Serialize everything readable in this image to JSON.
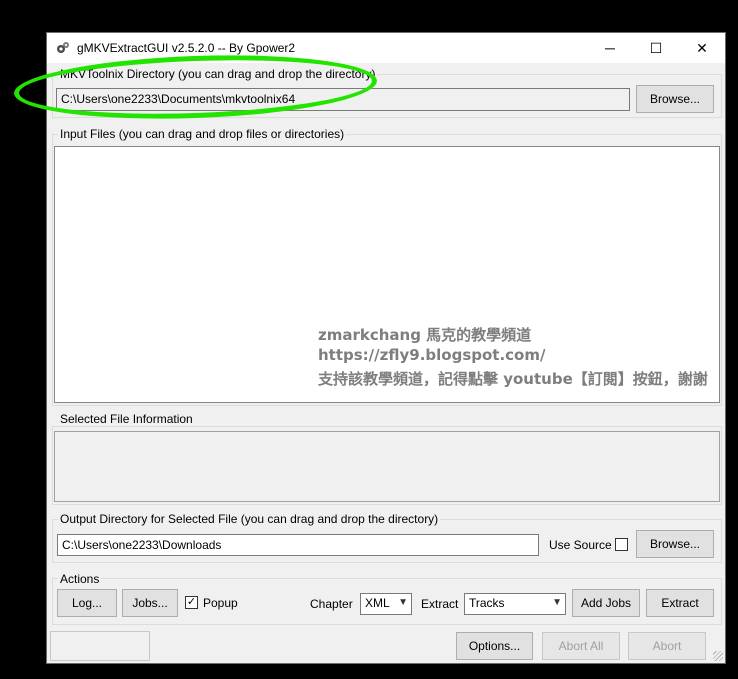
{
  "window": {
    "title": "gMKVExtractGUI v2.5.2.0 -- By Gpower2"
  },
  "window_controls": {
    "minimize": "─",
    "maximize": "☐",
    "close": "✕"
  },
  "mkvtoolnix": {
    "legend": "MKVToolnix Directory (you can drag and drop the directory)",
    "path": "C:\\Users\\one2233\\Documents\\mkvtoolnix64",
    "browse": "Browse..."
  },
  "input_files": {
    "legend": "Input Files (you can drag and drop files or directories)"
  },
  "watermark": {
    "line1": "zmarkchang 馬克的教學頻道",
    "line2": "https://zfly9.blogspot.com/",
    "line3": "支持該教學頻道，記得點擊 youtube【訂閱】按鈕，謝謝"
  },
  "selected_info": {
    "legend": "Selected File Information"
  },
  "output": {
    "legend": "Output Directory for Selected File (you can drag and drop the directory)",
    "path": "C:\\Users\\one2233\\Downloads",
    "use_source_label": "Use Source",
    "use_source_checked": false,
    "browse": "Browse..."
  },
  "actions": {
    "legend": "Actions",
    "log": "Log...",
    "jobs": "Jobs...",
    "popup_label": "Popup",
    "popup_checked": true,
    "chapter_label": "Chapter",
    "chapter_value": "XML",
    "extract_label": "Extract",
    "extract_value": "Tracks",
    "add_jobs": "Add Jobs",
    "extract_button": "Extract"
  },
  "bottom": {
    "options": "Options...",
    "abort_all": "Abort All",
    "abort": "Abort"
  },
  "colors": {
    "highlight": "#22e400",
    "watermark": "#7e7e7e"
  }
}
